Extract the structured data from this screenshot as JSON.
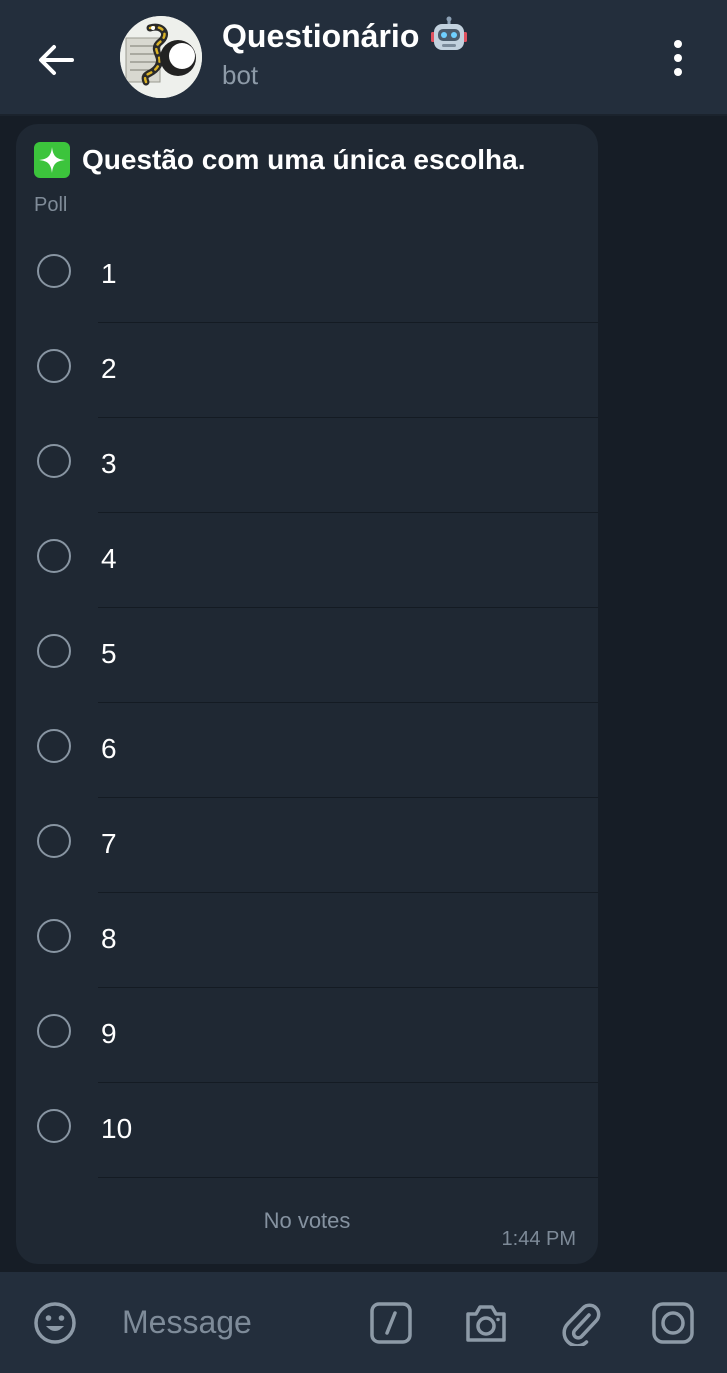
{
  "header": {
    "title": "Questionário",
    "subtitle": "bot",
    "back_icon": "arrow-left-icon",
    "badge_icon": "robot-face-icon",
    "menu_icon": "more-vertical-icon"
  },
  "poll": {
    "question": "Questão com uma única escolha.",
    "question_icon": "sparkles-icon",
    "type_label": "Poll",
    "options": [
      "1",
      "2",
      "3",
      "4",
      "5",
      "6",
      "7",
      "8",
      "9",
      "10"
    ],
    "footer_text": "No votes",
    "timestamp": "1:44 PM"
  },
  "composer": {
    "placeholder": "Message",
    "icons": [
      "emoji-icon",
      "bot-command-icon",
      "camera-icon",
      "attach-icon",
      "video-message-icon"
    ]
  },
  "colors": {
    "header_bg": "#232e3c",
    "chat_bg": "#161d26",
    "bubble_bg": "#1f2833",
    "secondary_text": "#8d9aa7",
    "accent_green": "#3cc43c"
  }
}
